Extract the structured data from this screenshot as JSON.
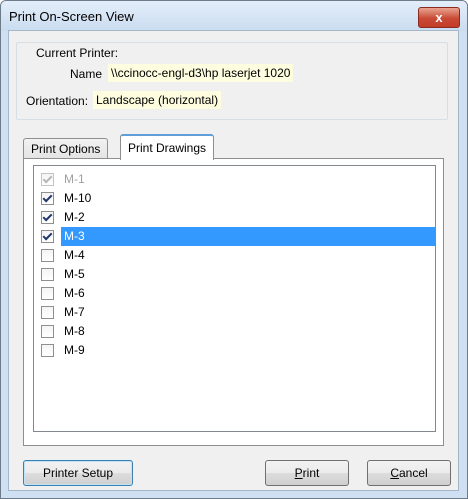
{
  "window": {
    "title": "Print On-Screen View",
    "close_label": "x"
  },
  "printer": {
    "group_label": "Current Printer:",
    "name_label": "Name",
    "name_value": "\\\\ccinocc-engl-d3\\hp laserjet 1020",
    "orientation_label": "Orientation:",
    "orientation_value": "Landscape (horizontal)"
  },
  "tabs": [
    {
      "label": "Print Options",
      "active": false
    },
    {
      "label": "Print Drawings",
      "active": true
    }
  ],
  "drawings": [
    {
      "label": "M-1",
      "checked": true,
      "disabled": true,
      "selected": false
    },
    {
      "label": "M-10",
      "checked": true,
      "disabled": false,
      "selected": false
    },
    {
      "label": "M-2",
      "checked": true,
      "disabled": false,
      "selected": false
    },
    {
      "label": "M-3",
      "checked": true,
      "disabled": false,
      "selected": true
    },
    {
      "label": "M-4",
      "checked": false,
      "disabled": false,
      "selected": false
    },
    {
      "label": "M-5",
      "checked": false,
      "disabled": false,
      "selected": false
    },
    {
      "label": "M-6",
      "checked": false,
      "disabled": false,
      "selected": false
    },
    {
      "label": "M-7",
      "checked": false,
      "disabled": false,
      "selected": false
    },
    {
      "label": "M-8",
      "checked": false,
      "disabled": false,
      "selected": false
    },
    {
      "label": "M-9",
      "checked": false,
      "disabled": false,
      "selected": false
    }
  ],
  "buttons": {
    "setup_label": "Printer Setup",
    "print_first": "P",
    "print_rest": "rint",
    "cancel_first": "C",
    "cancel_rest": "ancel"
  }
}
